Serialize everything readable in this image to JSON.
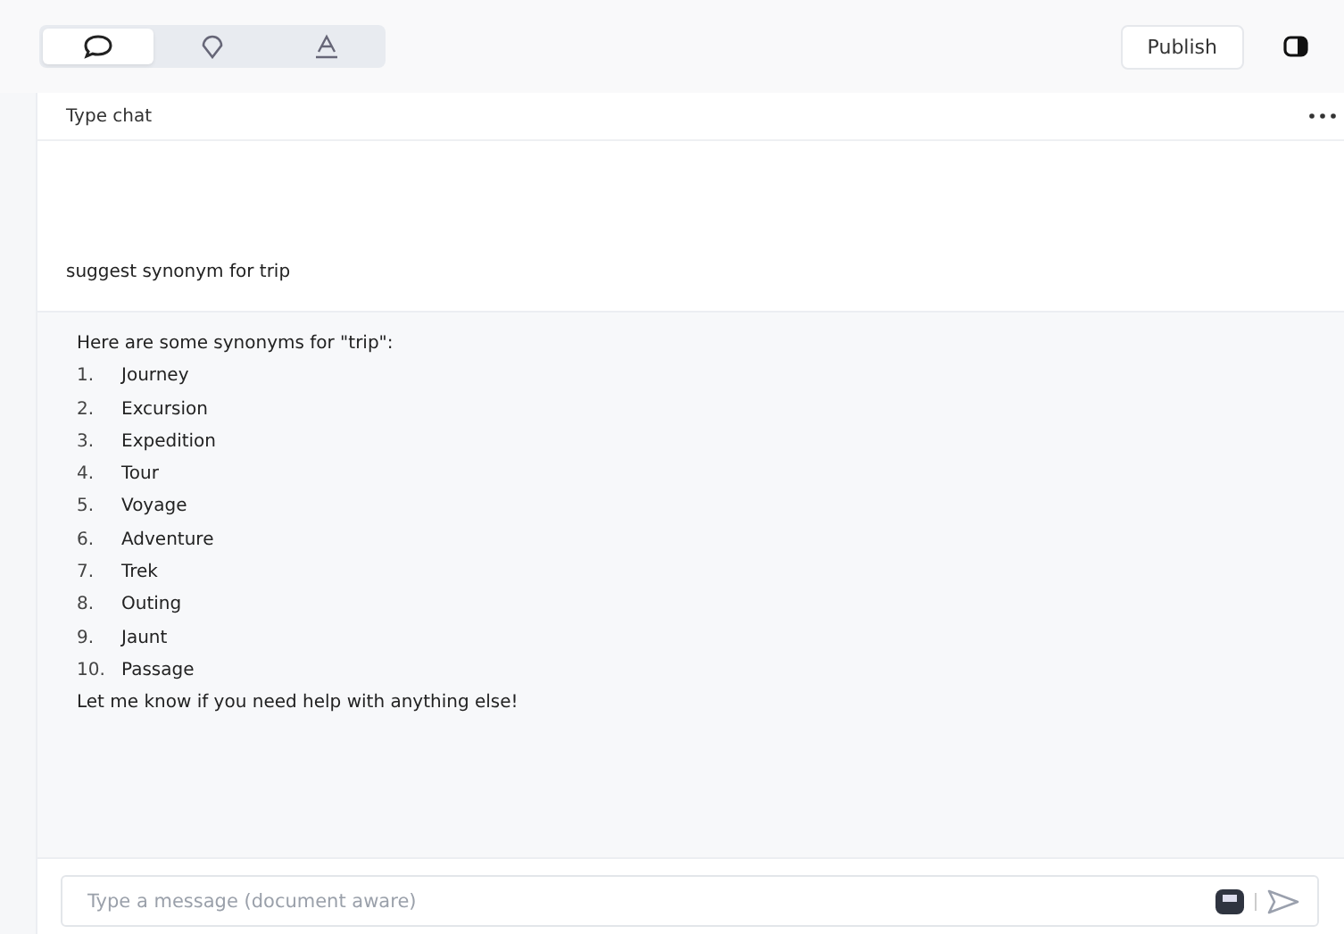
{
  "toolbar": {
    "tabs": [
      {
        "kind": "chat",
        "selected": true
      },
      {
        "kind": "pin",
        "selected": false
      },
      {
        "kind": "text",
        "selected": false
      }
    ],
    "publish": "Publish"
  },
  "chat": {
    "title": "Type chat",
    "user_message": "suggest synonym for trip",
    "reply": {
      "intro": "Here are some synonyms for \"trip\":",
      "items": [
        {
          "number": "1.",
          "text": "Journey"
        },
        {
          "number": "2.",
          "text": "Excursion"
        },
        {
          "number": "3.",
          "text": "Expedition"
        },
        {
          "number": "4.",
          "text": "Tour"
        },
        {
          "number": "5.",
          "text": "Voyage"
        },
        {
          "number": "6.",
          "text": "Adventure"
        },
        {
          "number": "7.",
          "text": "Trek"
        },
        {
          "number": "8.",
          "text": "Outing"
        },
        {
          "number": "9.",
          "text": "Jaunt"
        },
        {
          "number": "10.",
          "text": "Passage"
        }
      ],
      "outro": "Let me know if you need help with anything else!"
    },
    "input": {
      "placeholder": "Type a message (document aware)"
    }
  }
}
